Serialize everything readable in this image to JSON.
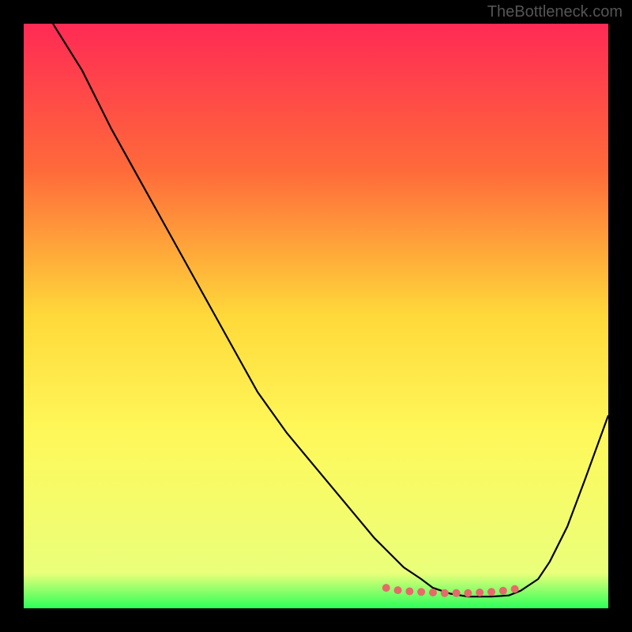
{
  "watermark": "TheBottleneck.com",
  "chart_data": {
    "type": "line",
    "title": "",
    "xlabel": "",
    "ylabel": "",
    "xlim": [
      0,
      100
    ],
    "ylim": [
      0,
      100
    ],
    "gradient_stops": [
      {
        "offset": 0,
        "color": "#ff2a55"
      },
      {
        "offset": 25,
        "color": "#ff6a3a"
      },
      {
        "offset": 50,
        "color": "#ffd93a"
      },
      {
        "offset": 70,
        "color": "#fff85a"
      },
      {
        "offset": 94,
        "color": "#eaff7a"
      },
      {
        "offset": 100,
        "color": "#2dff5a"
      }
    ],
    "series": [
      {
        "name": "curve",
        "color": "#000000",
        "x": [
          5,
          10,
          15,
          20,
          25,
          30,
          35,
          40,
          45,
          50,
          55,
          60,
          62,
          65,
          68,
          70,
          73,
          76,
          80,
          83,
          85,
          88,
          90,
          93,
          96,
          100
        ],
        "y": [
          100,
          92,
          82,
          73,
          64,
          55,
          46,
          37,
          30,
          24,
          18,
          12,
          10,
          7,
          5,
          3.5,
          2.5,
          2,
          2,
          2.2,
          3,
          5,
          8,
          14,
          22,
          33
        ]
      },
      {
        "name": "highlight",
        "color": "#e66a6a",
        "x": [
          62,
          64,
          66,
          68,
          70,
          72,
          74,
          76,
          78,
          80,
          82,
          84
        ],
        "y": [
          3.5,
          3.1,
          2.9,
          2.8,
          2.7,
          2.6,
          2.6,
          2.6,
          2.7,
          2.8,
          3.0,
          3.3
        ]
      }
    ]
  }
}
